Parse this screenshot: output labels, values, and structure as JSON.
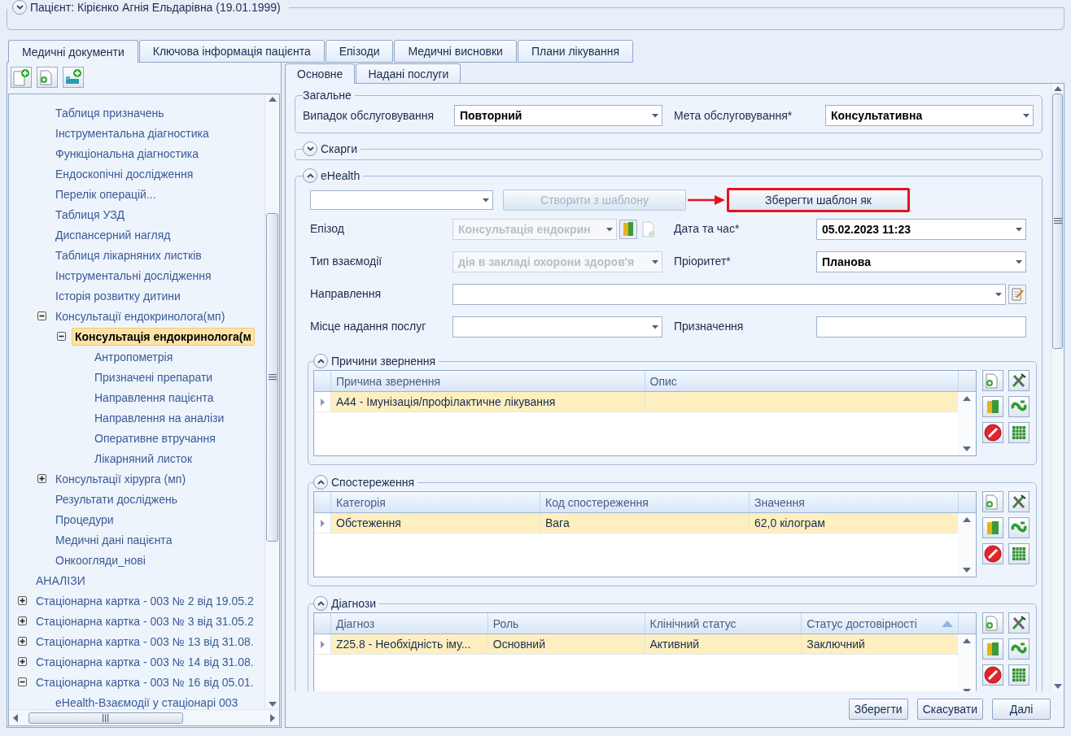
{
  "patient_header": {
    "title": "Пацієнт: Кірієнко Агнія Ельдарівна (19.01.1999)",
    "expanded": false
  },
  "tabs": [
    {
      "label": "Медичні документи",
      "selected": true
    },
    {
      "label": "Ключова інформація пацієнта",
      "selected": false
    },
    {
      "label": "Епізоди",
      "selected": false
    },
    {
      "label": "Медичні висновки",
      "selected": false
    },
    {
      "label": "Плани лікування",
      "selected": false
    }
  ],
  "tree": {
    "items": [
      {
        "children": [
          {
            "label": "Таблиця призначень",
            "selected": false
          },
          {
            "label": "Інструментальна діагностика",
            "selected": false
          },
          {
            "label": "Функціональна діагностика",
            "selected": false
          },
          {
            "label": "Ендоскопічні дослідження",
            "selected": false
          },
          {
            "label": "Перелік операцій...",
            "selected": false
          },
          {
            "label": "Таблиця УЗД",
            "selected": false
          },
          {
            "label": "Диспансерний нагляд",
            "selected": false
          },
          {
            "label": "Таблиця лікарняних листків",
            "selected": false
          },
          {
            "label": "Інструментальні дослідження",
            "selected": false
          },
          {
            "label": "Історія розвитку дитини",
            "selected": false
          },
          {
            "label": "Консультації ендокринолога(мп)",
            "expanded": true,
            "selected": false,
            "children": [
              {
                "label": "Консультація ендокринолога(м",
                "expanded": true,
                "selected": true,
                "children": [
                  {
                    "label": "Антропометрія",
                    "selected": false
                  },
                  {
                    "label": "Призначені препарати",
                    "selected": false
                  },
                  {
                    "label": "Направлення пацієнта",
                    "selected": false
                  },
                  {
                    "label": "Направлення на аналізи",
                    "selected": false
                  },
                  {
                    "label": "Оперативне втручання",
                    "selected": false
                  },
                  {
                    "label": "Лікарняний листок",
                    "selected": false
                  }
                ]
              }
            ]
          },
          {
            "label": "Консультації хірурга (мп)",
            "expanded": false,
            "selected": false
          },
          {
            "label": "Результати досліджень",
            "selected": false
          },
          {
            "label": "Процедури",
            "selected": false
          },
          {
            "label": "Медичні дані пацієнта",
            "selected": false
          },
          {
            "label": "Онкоогляди_нові",
            "selected": false
          }
        ]
      },
      {
        "label": "АНАЛІЗИ",
        "selected": false
      },
      {
        "label": "Стаціонарна картка - 003 № 2 від 19.05.2",
        "expanded": false,
        "selected": false
      },
      {
        "label": "Стаціонарна картка - 003 № 3 від 31.05.2",
        "expanded": false,
        "selected": false
      },
      {
        "label": "Стаціонарна картка - 003 № 13 від 31.08.",
        "expanded": false,
        "selected": false
      },
      {
        "label": "Стаціонарна картка - 003 № 14 від 31.08.",
        "expanded": false,
        "selected": false
      },
      {
        "label": "Стаціонарна картка - 003 № 16 від 05.01.",
        "expanded": true,
        "selected": false,
        "children": [
          {
            "label": "eHealth-Взаємодії у стаціонарі 003",
            "selected": false
          }
        ]
      }
    ]
  },
  "inner_tabs": [
    {
      "label": "Основне",
      "selected": true
    },
    {
      "label": "Надані послуги",
      "selected": false
    }
  ],
  "general": {
    "title": "Загальне",
    "fields": [
      {
        "label": "Випадок обслуговування",
        "value": "Повторний"
      },
      {
        "label": "Мета обслуговування*",
        "value": "Консультативна"
      }
    ]
  },
  "complaints": {
    "title": "Скарги",
    "expanded": false
  },
  "ehealth": {
    "title": "eHealth",
    "expanded": true,
    "template_buttons": [
      {
        "label": "Створити з шаблону",
        "disabled": true,
        "highlighted": false
      },
      {
        "label": "Зберегти шаблон як",
        "disabled": false,
        "highlighted": true
      }
    ],
    "rows": [
      [
        {
          "label": "Епізод",
          "value": "Консультація ендокрин",
          "kind": "lookup",
          "disabled": true
        },
        {
          "label": "Дата та час*",
          "value": "05.02.2023 11:23",
          "kind": "combo",
          "disabled": false
        }
      ],
      [
        {
          "label": "Тип взаємодії",
          "value": "дія в закладі охорони здоров'я",
          "kind": "combo",
          "disabled": true
        },
        {
          "label": "Пріоритет*",
          "value": "Планова",
          "kind": "combo",
          "disabled": false
        }
      ],
      [
        {
          "label": "Направлення",
          "kind": "edit",
          "disabled": false
        }
      ],
      [
        {
          "label": "Місце надання послуг",
          "kind": "combo",
          "disabled": false
        },
        {
          "label": "Призначення",
          "kind": "text",
          "disabled": false
        }
      ]
    ]
  },
  "sections": [
    {
      "title": "Причини звернення",
      "expanded": true,
      "columns": [
        {
          "label": "Причина звернення",
          "sorted": false
        },
        {
          "label": "Опис",
          "sorted": false
        }
      ],
      "rows": [
        {
          "cells": [
            "A44 - Імунізація/профілактичне лікування",
            ""
          ],
          "selected": true
        }
      ]
    },
    {
      "title": "Спостереження",
      "expanded": true,
      "columns": [
        {
          "label": "Категорія",
          "sorted": false
        },
        {
          "label": "Код спостереження",
          "sorted": false
        },
        {
          "label": "Значення",
          "sorted": false
        }
      ],
      "rows": [
        {
          "cells": [
            "Обстеження",
            "Вага",
            "62,0 кілограм"
          ],
          "selected": true
        }
      ]
    },
    {
      "title": "Діагнози",
      "expanded": true,
      "columns": [
        {
          "label": "Діагноз",
          "sorted": false
        },
        {
          "label": "Роль",
          "sorted": false
        },
        {
          "label": "Клінічний статус",
          "sorted": false
        },
        {
          "label": "Статус достовірності",
          "sorted": true
        }
      ],
      "rows": [
        {
          "cells": [
            "Z25.8 - Необхідність іму...",
            "Основний",
            "Активний",
            "Заключний"
          ],
          "selected": true
        }
      ]
    }
  ],
  "buttons": [
    "Зберегти",
    "Скасувати",
    "Далі"
  ]
}
